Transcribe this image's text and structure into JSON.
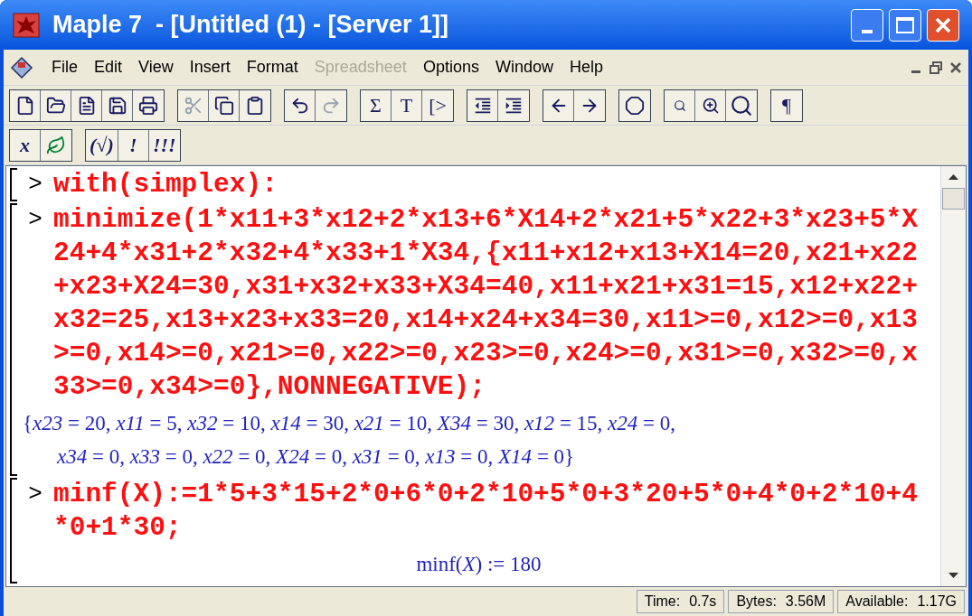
{
  "window": {
    "title": "Maple 7  - [Untitled (1) - [Server 1]]"
  },
  "menu": [
    {
      "label": "File",
      "disabled": false
    },
    {
      "label": "Edit",
      "disabled": false
    },
    {
      "label": "View",
      "disabled": false
    },
    {
      "label": "Insert",
      "disabled": false
    },
    {
      "label": "Format",
      "disabled": false
    },
    {
      "label": "Spreadsheet",
      "disabled": true
    },
    {
      "label": "Options",
      "disabled": false
    },
    {
      "label": "Window",
      "disabled": false
    },
    {
      "label": "Help",
      "disabled": false
    }
  ],
  "toolbar": [
    [
      {
        "kind": "new",
        "disabled": false
      },
      {
        "kind": "open",
        "disabled": false
      },
      {
        "kind": "info",
        "disabled": false
      },
      {
        "kind": "save",
        "disabled": false
      },
      {
        "kind": "print",
        "disabled": false
      }
    ],
    [
      {
        "kind": "cut",
        "disabled": true
      },
      {
        "kind": "copy",
        "disabled": false
      },
      {
        "kind": "paste",
        "disabled": false
      }
    ],
    [
      {
        "kind": "undo",
        "disabled": false
      },
      {
        "kind": "redo",
        "disabled": true
      }
    ],
    [
      {
        "kind": "glyph",
        "label": "Σ",
        "disabled": false
      },
      {
        "kind": "glyph",
        "label": "T",
        "disabled": false
      },
      {
        "kind": "glyph",
        "label": "[>",
        "disabled": false
      }
    ],
    [
      {
        "kind": "outdent",
        "disabled": false
      },
      {
        "kind": "indent",
        "disabled": false
      }
    ],
    [
      {
        "kind": "back",
        "disabled": false
      },
      {
        "kind": "forward",
        "disabled": false
      }
    ],
    [
      {
        "kind": "stop",
        "disabled": false
      }
    ],
    [
      {
        "kind": "zoomsmall",
        "disabled": false
      },
      {
        "kind": "zoommid",
        "disabled": false
      },
      {
        "kind": "zoomlarge",
        "disabled": false
      }
    ],
    [
      {
        "kind": "glyph",
        "label": "¶",
        "disabled": false
      }
    ]
  ],
  "palette": [
    [
      {
        "kind": "glyph",
        "label": "x"
      },
      {
        "kind": "leaf"
      }
    ],
    [
      {
        "kind": "glyph",
        "label": "(√)"
      },
      {
        "kind": "glyph",
        "label": "!"
      },
      {
        "kind": "glyph",
        "label": "!!!"
      }
    ]
  ],
  "worksheet": {
    "groups": [
      {
        "prompt": ">",
        "input": [
          "with(simplex):"
        ]
      },
      {
        "prompt": ">",
        "input": [
          "minimize(1*x11+3*x12+2*x13+6*X14+2*x21+5*x22+3*x23+5*X",
          "24+4*x31+2*x32+4*x33+1*X34,{x11+x12+x13+X14=20,x21+x22",
          "+x23+X24=30,x31+x32+x33+X34=40,x11+x21+x31=15,x12+x22+",
          "x32=25,x13+x23+x33=20,x14+x24+x34=30,x11>=0,x12>=0,x13",
          ">=0,x14>=0,x21>=0,x22>=0,x23>=0,x24>=0,x31>=0,x32>=0,x",
          "33>=0,x34>=0},NONNEGATIVE);"
        ],
        "output": [
          "{*x23* = 20, *x11* = 5, *x32* = 10, *x14* = 30, *x21* = 10, *X34* = 30, *x12* = 15, *x24* = 0,",
          "*x34* = 0, *x33* = 0, *x22* = 0, *X24* = 0, *x31* = 0, *x13* = 0, *X14* = 0}"
        ],
        "output_centered": false
      },
      {
        "prompt": ">",
        "input": [
          "minf(X):=1*5+3*15+2*0+6*0+2*10+5*0+3*20+5*0+4*0+2*10+4",
          "*0+1*30;"
        ],
        "output": [
          "minf(*X*) := 180"
        ],
        "output_centered": true
      }
    ]
  },
  "status_bar": [
    {
      "label": "Time:",
      "value": "0.7s"
    },
    {
      "label": "Bytes:",
      "value": "3.56M"
    },
    {
      "label": "Available:",
      "value": "1.17G"
    }
  ]
}
